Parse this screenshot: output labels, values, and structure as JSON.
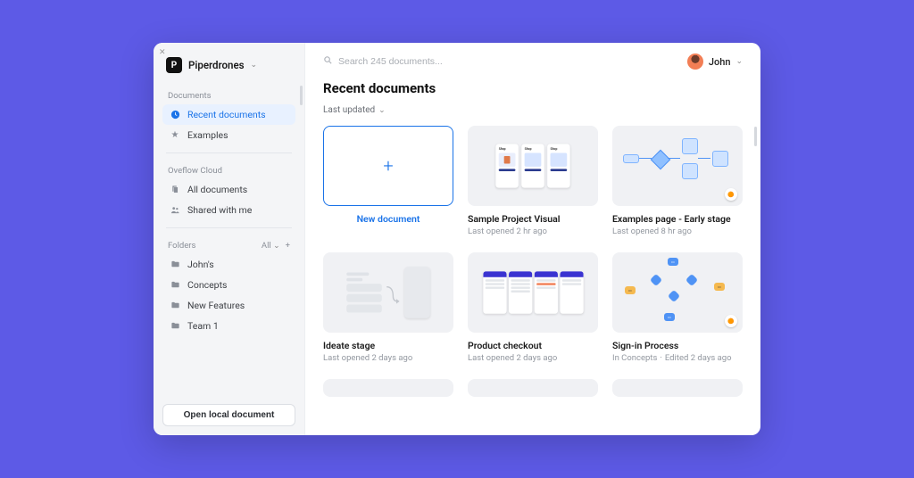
{
  "workspace": {
    "initial": "P",
    "name": "Piperdrones"
  },
  "sidebar": {
    "section_documents": "Documents",
    "recent": "Recent documents",
    "examples": "Examples",
    "section_cloud": "Oveflow Cloud",
    "all_docs": "All documents",
    "shared": "Shared with me",
    "section_folders": "Folders",
    "folders_filter": "All",
    "folders": {
      "f0": "John's",
      "f1": "Concepts",
      "f2": "New Features",
      "f3": "Team 1"
    },
    "open_local": "Open local document"
  },
  "search": {
    "placeholder": "Search 245 documents..."
  },
  "user": {
    "name": "John"
  },
  "page": {
    "title": "Recent documents",
    "sort": "Last updated"
  },
  "cards": {
    "new_label": "New document",
    "c1": {
      "title": "Sample Project Visual",
      "meta": "Last opened 2 hr ago"
    },
    "c2": {
      "title": "Examples page - Early stage",
      "meta": "Last opened 8 hr ago"
    },
    "c3": {
      "title": "Ideate stage",
      "meta": "Last opened 2 days ago"
    },
    "c4": {
      "title": "Product checkout",
      "meta": "Last opened 2 days ago"
    },
    "c5": {
      "title": "Sign-in Process",
      "meta_prefix": "In Concepts",
      "meta_suffix": "Edited 2 days ago"
    }
  }
}
